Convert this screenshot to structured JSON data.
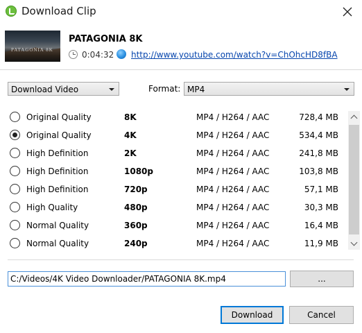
{
  "window": {
    "title": "Download Clip",
    "close_label": "×"
  },
  "video": {
    "title": "PATAGONIA 8K",
    "thumbnail_text": "PATAGONIA 8K",
    "duration": "0:04:32",
    "url": "http://www.youtube.com/watch?v=ChOhcHD8fBA"
  },
  "action": {
    "selected": "Download Video"
  },
  "format": {
    "label": "Format:",
    "selected": "MP4"
  },
  "options": [
    {
      "quality": "Original Quality",
      "resolution": "8K",
      "codec": "MP4 / H264 / AAC",
      "size": "728,4 MB",
      "selected": false
    },
    {
      "quality": "Original Quality",
      "resolution": "4K",
      "codec": "MP4 / H264 / AAC",
      "size": "534,4 MB",
      "selected": true
    },
    {
      "quality": "High Definition",
      "resolution": "2K",
      "codec": "MP4 / H264 / AAC",
      "size": "241,8 MB",
      "selected": false
    },
    {
      "quality": "High Definition",
      "resolution": "1080p",
      "codec": "MP4 / H264 / AAC",
      "size": "103,8 MB",
      "selected": false
    },
    {
      "quality": "High Definition",
      "resolution": "720p",
      "codec": "MP4 / H264 / AAC",
      "size": "57,1 MB",
      "selected": false
    },
    {
      "quality": "High Quality",
      "resolution": "480p",
      "codec": "MP4 / H264 / AAC",
      "size": "30,3 MB",
      "selected": false
    },
    {
      "quality": "Normal Quality",
      "resolution": "360p",
      "codec": "MP4 / H264 / AAC",
      "size": "16,4 MB",
      "selected": false
    },
    {
      "quality": "Normal Quality",
      "resolution": "240p",
      "codec": "MP4 / H264 / AAC",
      "size": "11,9 MB",
      "selected": false
    }
  ],
  "save_path": {
    "value": "C:/Videos/4K Video Downloader/PATAGONIA 8K.mp4"
  },
  "buttons": {
    "browse": "...",
    "download": "Download",
    "cancel": "Cancel"
  },
  "colors": {
    "link": "#0645ad",
    "focus_border": "#0078d7",
    "app_icon": "#6cbf3e"
  }
}
